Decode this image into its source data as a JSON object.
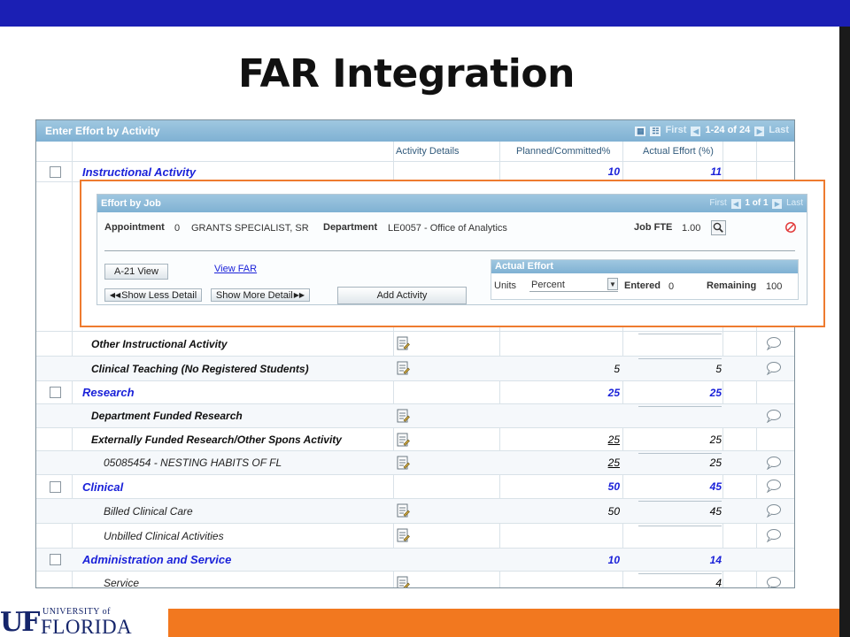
{
  "slide": {
    "title": "FAR Integration"
  },
  "grid": {
    "title": "Enter Effort by Activity",
    "nav": {
      "first": "First",
      "count": "1-24 of 24",
      "last": "Last"
    },
    "columns": {
      "details": "Activity Details",
      "planned": "Planned/Committed%",
      "actual": "Actual Effort (%)"
    },
    "rows": [
      {
        "label": "Instructional Activity",
        "planned": "10",
        "actual": "11"
      },
      {
        "label": "Other Instructional Activity",
        "planned": "",
        "actual": ""
      },
      {
        "label": "Clinical Teaching (No Registered Students)",
        "planned": "5",
        "actual": "5"
      },
      {
        "label": "Research",
        "planned": "25",
        "actual": "25"
      },
      {
        "label": "Department Funded Research",
        "planned": "",
        "actual": ""
      },
      {
        "label": "Externally Funded Research/Other Spons Activity",
        "planned": "25",
        "actual": "25"
      },
      {
        "label": "05085454 -  NESTING HABITS OF FL",
        "planned": "25",
        "actual": "25"
      },
      {
        "label": "Clinical",
        "planned": "50",
        "actual": "45"
      },
      {
        "label": "Billed Clinical Care",
        "planned": "50",
        "actual": "45"
      },
      {
        "label": "Unbilled Clinical Activities",
        "planned": "",
        "actual": ""
      },
      {
        "label": "Administration and Service",
        "planned": "10",
        "actual": "14"
      },
      {
        "label": "Service",
        "planned": "",
        "actual": "4"
      }
    ]
  },
  "job": {
    "title": "Effort by Job",
    "nav": {
      "first": "First",
      "count": "1 of 1",
      "last": "Last"
    },
    "appointment_label": "Appointment",
    "appointment_value": "0",
    "job_title": "GRANTS SPECIALIST, SR",
    "department_label": "Department",
    "department_value": "LE0057 - Office of Analytics",
    "fte_label": "Job FTE",
    "fte_value": "1.00",
    "a21_button": "A-21 View",
    "view_far_link": "View FAR",
    "show_less": "Show Less Detail",
    "show_more": "Show More Detail",
    "add_activity": "Add Activity",
    "actual_effort": {
      "title": "Actual Effort",
      "units_label": "Units",
      "units_value": "Percent",
      "entered_label": "Entered",
      "entered_value": "0",
      "remaining_label": "Remaining",
      "remaining_value": "100"
    }
  },
  "logo": {
    "mark": "UF",
    "small": "UNIVERSITY of",
    "big": "FLORIDA"
  },
  "colors": {
    "header_blue": "#1b1fb4",
    "accent_orange": "#f2781f",
    "link_blue": "#1b22d9"
  }
}
